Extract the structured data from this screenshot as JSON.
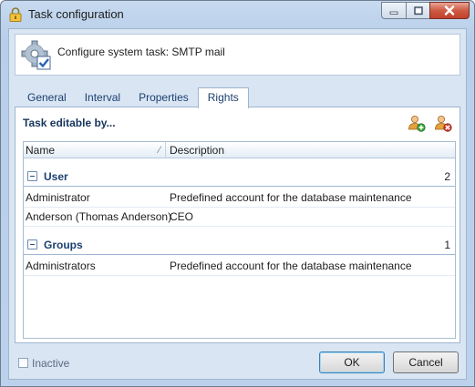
{
  "window": {
    "title": "Task configuration"
  },
  "header": {
    "text": "Configure system task: SMTP mail"
  },
  "tabs": [
    {
      "label": "General",
      "active": false
    },
    {
      "label": "Interval",
      "active": false
    },
    {
      "label": "Properties",
      "active": false
    },
    {
      "label": "Rights",
      "active": true
    }
  ],
  "rights": {
    "section_title": "Task editable by...",
    "add_icon": "user-add-icon",
    "remove_icon": "user-remove-icon",
    "columns": {
      "name": "Name",
      "description": "Description"
    },
    "groups": [
      {
        "label": "User",
        "count": "2",
        "rows": [
          {
            "name": "Administrator",
            "description": "Predefined account for the database maintenance"
          },
          {
            "name": "Anderson (Thomas Anderson)",
            "description": "CEO"
          }
        ]
      },
      {
        "label": "Groups",
        "count": "1",
        "rows": [
          {
            "name": "Administrators",
            "description": "Predefined account for the database maintenance"
          }
        ]
      }
    ]
  },
  "footer": {
    "inactive_label": "Inactive",
    "inactive_checked": false,
    "ok_label": "OK",
    "cancel_label": "Cancel"
  },
  "colors": {
    "accent": "#1c3f70",
    "frame": "#c6daf0"
  }
}
